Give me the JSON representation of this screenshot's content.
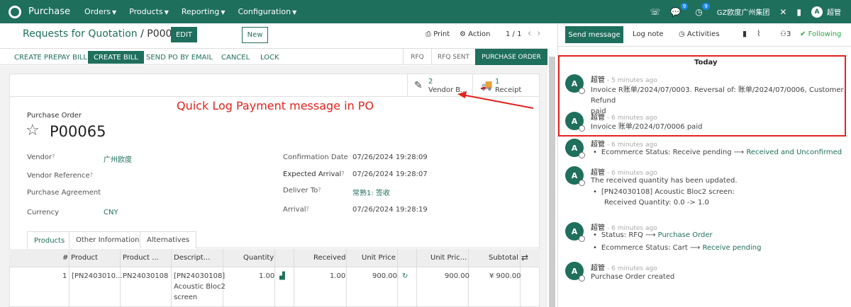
{
  "topbar": {
    "app_name": "Purchase",
    "menus": [
      "Orders",
      "Products",
      "Reporting",
      "Configuration"
    ],
    "messages_badge": "9",
    "activities_badge": "9",
    "company": "GZ欧度广州集团",
    "avatar_initial": "A",
    "username": "超管"
  },
  "control": {
    "breadcrumb_parent": "Requests for Quotation",
    "breadcrumb_sep": "/",
    "breadcrumb_current": "P00065",
    "edit_label": "EDIT",
    "new_label": "New",
    "print_label": "Print",
    "action_label": "Action",
    "pager": "1 / 1"
  },
  "statusbar": {
    "buttons": [
      "CREATE PREPAY BILL",
      "CREATE BILL",
      "SEND PO BY EMAIL",
      "CANCEL",
      "LOCK"
    ],
    "stages": [
      "RFQ",
      "RFQ SENT",
      "PURCHASE ORDER"
    ]
  },
  "smart_buttons": {
    "vendor_bills_count": "2",
    "vendor_bills_label": "Vendor B...",
    "receipt_count": "1",
    "receipt_label": "Receipt"
  },
  "annotation": "Quick Log Payment message in PO",
  "form": {
    "doc_type": "Purchase Order",
    "name": "P00065",
    "vendor_label": "Vendor",
    "vendor_value": "广州欧度",
    "vendor_ref_label": "Vendor Reference",
    "agreement_label": "Purchase Agreement",
    "currency_label": "Currency",
    "currency_value": "CNY",
    "confirmation_label": "Confirmation Date",
    "confirmation_value": "07/26/2024 19:28:09",
    "expected_label": "Expected Arrival",
    "expected_value": "07/26/2024 19:28:07",
    "deliver_label": "Deliver To",
    "deliver_value": "常熟1: 签收",
    "arrival_label": "Arrival",
    "arrival_value": "07/26/2024 19:28:19"
  },
  "tabs": [
    "Products",
    "Other Information",
    "Alternatives"
  ],
  "grid": {
    "headers": [
      "#",
      "Product",
      "Product ...",
      "Descript...",
      "Quantity",
      "Received",
      "Unit Price",
      "Unit Pric...",
      "Subtotal"
    ],
    "row": {
      "index": "1",
      "product": "[PN2403010...",
      "product_code": "PN24030108",
      "desc_1": "[PN24030108]",
      "desc_2": "Acoustic Bloc2",
      "desc_3": "screen",
      "quantity": "1.00",
      "received": "1.00",
      "unit_price": "900.00",
      "unit_price_2": "900.00",
      "subtotal": "¥ 900.00"
    }
  },
  "chatter": {
    "send_message": "Send message",
    "log_note": "Log note",
    "activities": "Activities",
    "followers_count": "3",
    "following": "Following",
    "today": "Today",
    "messages": [
      {
        "author": "超管",
        "ago": "- 5 minutes ago",
        "line1": "Invoice R账单/2024/07/0003. Reversal of: 账单/2024/07/0006, Customer Refund",
        "line2": "paid"
      },
      {
        "author": "超管",
        "ago": "- 6 minutes ago",
        "line1": "Invoice 账单/2024/07/0006 paid"
      },
      {
        "author": "超管",
        "ago": "- 6 minutes ago",
        "t1_label": "Ecommerce Status: Receive pending",
        "t1_new": "Received and Unconfirmed"
      },
      {
        "author": "超管",
        "ago": "- 6 minutes ago",
        "line1": "The received quantity has been updated.",
        "sub1": "[PN24030108] Acoustic Bloc2 screen:",
        "sub2": "Received Quantity: 0.0 -> 1.0"
      },
      {
        "author": "超管",
        "ago": "- 6 minutes ago",
        "t1_label": "Status: RFQ",
        "t1_new": "Purchase Order",
        "t2_label": "Ecommerce Status: Cart",
        "t2_new": "Receive pending"
      },
      {
        "author": "超管",
        "ago": "- 6 minutes ago",
        "line1": "Purchase Order created"
      }
    ]
  }
}
